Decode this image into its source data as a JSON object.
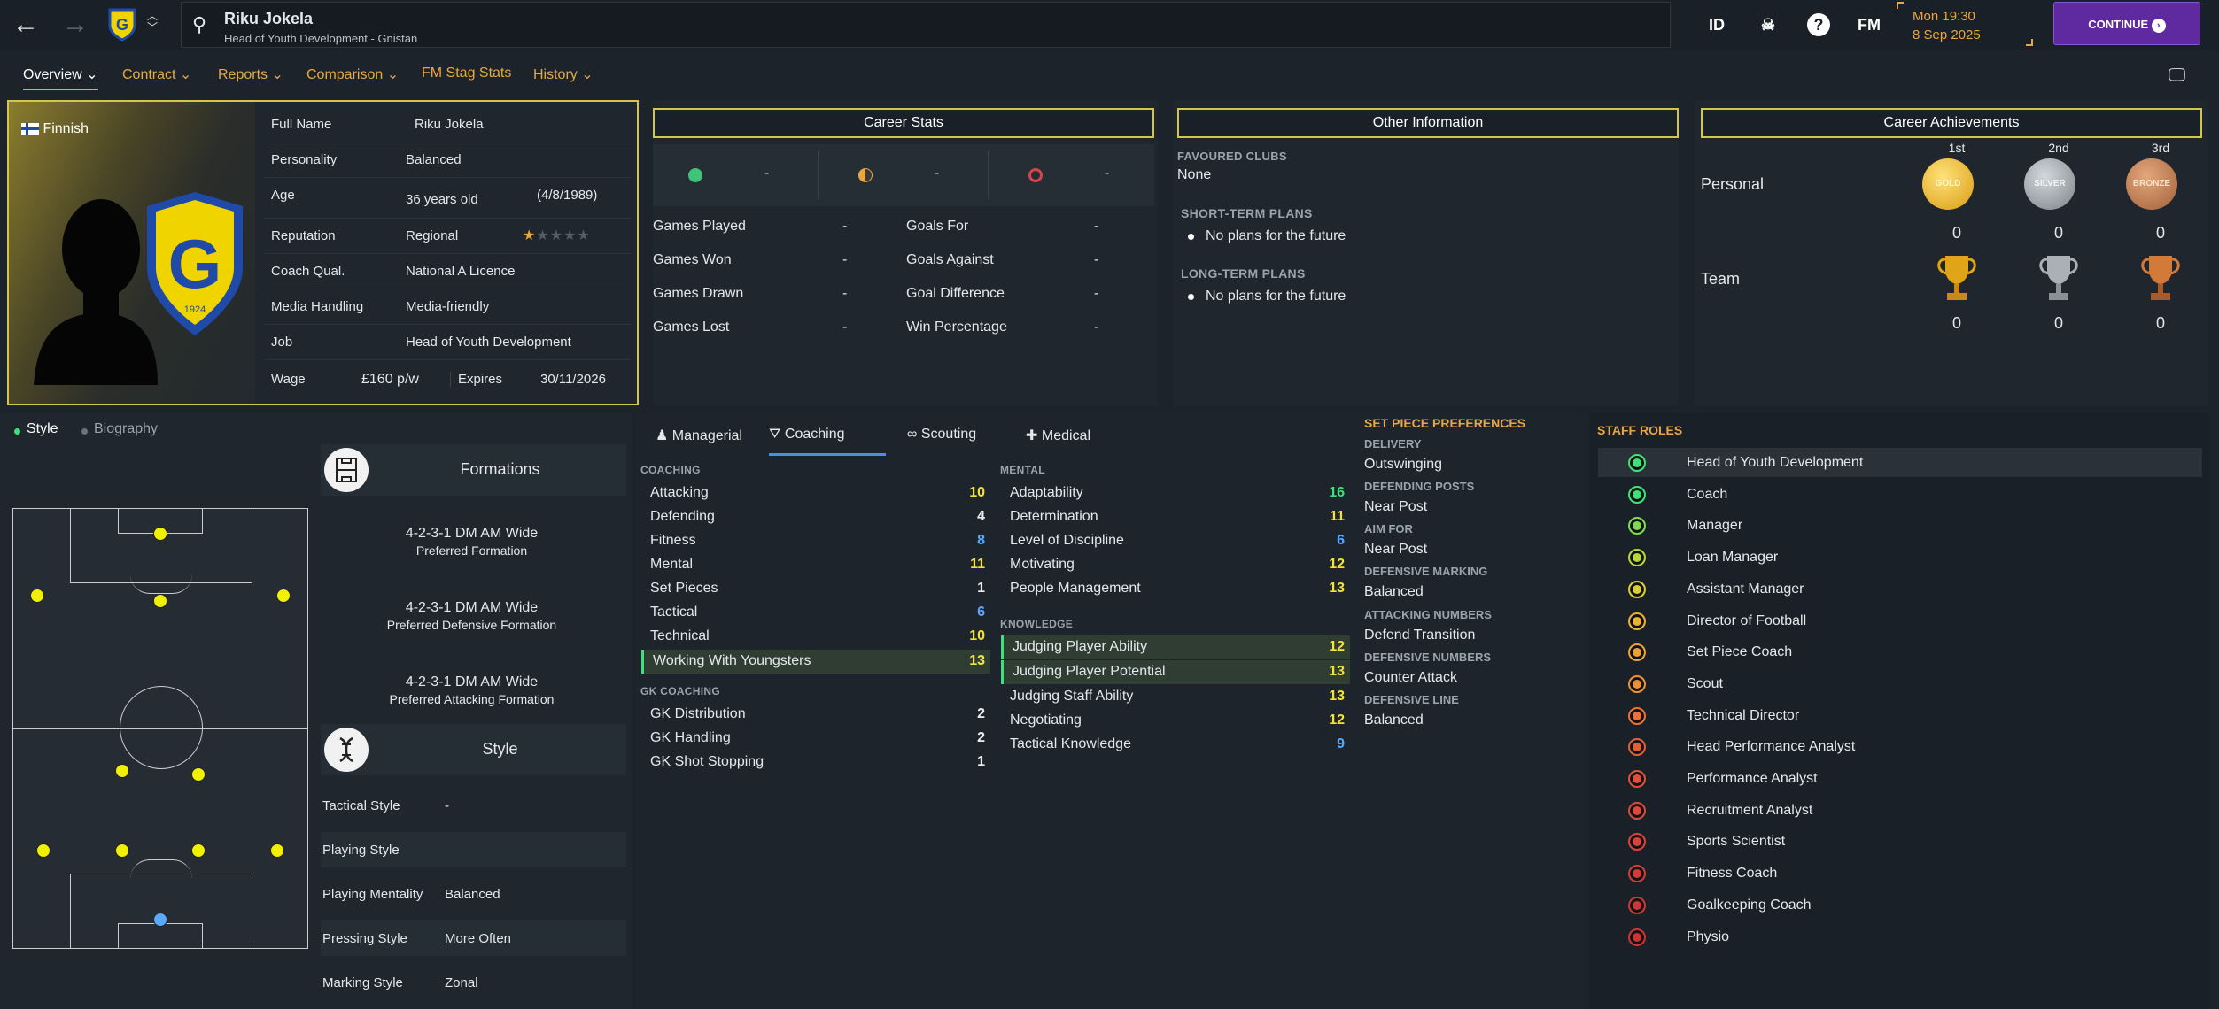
{
  "header": {
    "name": "Riku Jokela",
    "subtitle": "Head of Youth Development - Gnistan",
    "icons": [
      "ID",
      "☠",
      "?",
      "FM"
    ],
    "time": "Mon 19:30",
    "date": "8 Sep 2025",
    "continue": "CONTINUE"
  },
  "menu": [
    "Overview",
    "Contract",
    "Reports",
    "Comparison",
    "FM Stag Stats",
    "History"
  ],
  "profile": {
    "nationality": "Finnish",
    "crest_year": "1924",
    "rows": [
      {
        "label": "Full Name",
        "value": "Riku Jokela"
      },
      {
        "label": "Personality",
        "value": "Balanced"
      },
      {
        "label": "Age",
        "value": "36 years old",
        "extra": "(4/8/1989)"
      },
      {
        "label": "Reputation",
        "value": "Regional"
      },
      {
        "label": "Coach Qual.",
        "value": "National A Licence"
      },
      {
        "label": "Media Handling",
        "value": "Media-friendly"
      },
      {
        "label": "Job",
        "value": "Head of Youth Development"
      }
    ],
    "wage_label": "Wage",
    "wage": "£160 p/w",
    "expires_label": "Expires",
    "expires": "30/11/2026",
    "reputation_stars": 0.5
  },
  "career_stats": {
    "title": "Career Stats",
    "summary": [
      "-",
      "-",
      "-"
    ],
    "rows": [
      {
        "l": "Games Played",
        "v": "-",
        "l2": "Goals For",
        "v2": "-"
      },
      {
        "l": "Games Won",
        "v": "-",
        "l2": "Goals Against",
        "v2": "-"
      },
      {
        "l": "Games Drawn",
        "v": "-",
        "l2": "Goal Difference",
        "v2": "-"
      },
      {
        "l": "Games Lost",
        "v": "-",
        "l2": "Win Percentage",
        "v2": "-"
      }
    ]
  },
  "other_info": {
    "title": "Other Information",
    "favoured_label": "FAVOURED CLUBS",
    "favoured": "None",
    "short_label": "SHORT-TERM PLANS",
    "short": "No plans for the future",
    "long_label": "LONG-TERM PLANS",
    "long": "No plans for the future"
  },
  "achievements": {
    "title": "Career Achievements",
    "cols": [
      "1st",
      "2nd",
      "3rd"
    ],
    "personal_label": "Personal",
    "team_label": "Team",
    "medals": [
      "GOLD",
      "SILVER",
      "BRONZE"
    ],
    "personal": [
      "0",
      "0",
      "0"
    ],
    "team": [
      "0",
      "0",
      "0"
    ]
  },
  "left_tabs": [
    "Style",
    "Biography"
  ],
  "formations": {
    "title": "Formations",
    "items": [
      {
        "name": "4-2-3-1 DM AM Wide",
        "desc": "Preferred Formation"
      },
      {
        "name": "4-2-3-1 DM AM Wide",
        "desc": "Preferred Defensive Formation"
      },
      {
        "name": "4-2-3-1 DM AM Wide",
        "desc": "Preferred Attacking Formation"
      }
    ]
  },
  "style": {
    "title": "Style",
    "rows": [
      {
        "l": "Tactical Style",
        "v": "-"
      },
      {
        "l": "Playing Style",
        "v": ""
      },
      {
        "l": "Playing Mentality",
        "v": "Balanced"
      },
      {
        "l": "Pressing Style",
        "v": "More Often"
      },
      {
        "l": "Marking Style",
        "v": "Zonal"
      }
    ]
  },
  "attr_tabs": [
    "Managerial",
    "Coaching",
    "Scouting",
    "Medical"
  ],
  "coaching": {
    "label": "COACHING",
    "items": [
      {
        "n": "Attacking",
        "v": "10",
        "c": "yel"
      },
      {
        "n": "Defending",
        "v": "4",
        "c": "white"
      },
      {
        "n": "Fitness",
        "v": "8",
        "c": "blue"
      },
      {
        "n": "Mental",
        "v": "11",
        "c": "yel"
      },
      {
        "n": "Set Pieces",
        "v": "1",
        "c": "white"
      },
      {
        "n": "Tactical",
        "v": "6",
        "c": "blue"
      },
      {
        "n": "Technical",
        "v": "10",
        "c": "yel"
      },
      {
        "n": "Working With Youngsters",
        "v": "13",
        "c": "yel",
        "hl": true
      }
    ]
  },
  "gk": {
    "label": "GK COACHING",
    "items": [
      {
        "n": "GK Distribution",
        "v": "2",
        "c": "white"
      },
      {
        "n": "GK Handling",
        "v": "2",
        "c": "white"
      },
      {
        "n": "GK Shot Stopping",
        "v": "1",
        "c": "white"
      }
    ]
  },
  "mental": {
    "label": "MENTAL",
    "items": [
      {
        "n": "Adaptability",
        "v": "16",
        "c": "green"
      },
      {
        "n": "Determination",
        "v": "11",
        "c": "yel"
      },
      {
        "n": "Level of Discipline",
        "v": "6",
        "c": "blue"
      },
      {
        "n": "Motivating",
        "v": "12",
        "c": "yel"
      },
      {
        "n": "People Management",
        "v": "13",
        "c": "yel"
      }
    ]
  },
  "knowledge": {
    "label": "KNOWLEDGE",
    "items": [
      {
        "n": "Judging Player Ability",
        "v": "12",
        "c": "yel",
        "hl": true
      },
      {
        "n": "Judging Player Potential",
        "v": "13",
        "c": "yel",
        "hl": true
      },
      {
        "n": "Judging Staff Ability",
        "v": "13",
        "c": "yel"
      },
      {
        "n": "Negotiating",
        "v": "12",
        "c": "yel"
      },
      {
        "n": "Tactical Knowledge",
        "v": "9",
        "c": "blue"
      }
    ]
  },
  "set_piece": {
    "title": "SET PIECE PREFERENCES",
    "items": [
      {
        "l": "DELIVERY",
        "v": "Outswinging"
      },
      {
        "l": "DEFENDING POSTS",
        "v": "Near Post"
      },
      {
        "l": "AIM FOR",
        "v": "Near Post"
      },
      {
        "l": "DEFENSIVE MARKING",
        "v": "Balanced"
      },
      {
        "l": "ATTACKING NUMBERS",
        "v": "Defend Transition"
      },
      {
        "l": "DEFENSIVE NUMBERS",
        "v": "Counter Attack"
      },
      {
        "l": "DEFENSIVE LINE",
        "v": "Balanced"
      }
    ]
  },
  "staff_roles": {
    "title": "STAFF ROLES",
    "items": [
      {
        "n": "Head of Youth Development",
        "c": "#3fe07a"
      },
      {
        "n": "Coach",
        "c": "#3fe07a"
      },
      {
        "n": "Manager",
        "c": "#7ed957"
      },
      {
        "n": "Loan Manager",
        "c": "#b6d63a"
      },
      {
        "n": "Assistant Manager",
        "c": "#d6cf3a"
      },
      {
        "n": "Director of Football",
        "c": "#e8b23a"
      },
      {
        "n": "Set Piece Coach",
        "c": "#e8a23a"
      },
      {
        "n": "Scout",
        "c": "#e8923a"
      },
      {
        "n": "Technical Director",
        "c": "#e8723a"
      },
      {
        "n": "Head Performance Analyst",
        "c": "#e0603a"
      },
      {
        "n": "Performance Analyst",
        "c": "#e0503a"
      },
      {
        "n": "Recruitment Analyst",
        "c": "#d84a3a"
      },
      {
        "n": "Sports Scientist",
        "c": "#d8443a"
      },
      {
        "n": "Fitness Coach",
        "c": "#d03c3a"
      },
      {
        "n": "Goalkeeping Coach",
        "c": "#cc3838"
      },
      {
        "n": "Physio",
        "c": "#cc3434"
      }
    ]
  },
  "colors": {
    "accent": "#e9a742",
    "highlight": "#d4c54c",
    "continue": "#5f2aa0"
  }
}
